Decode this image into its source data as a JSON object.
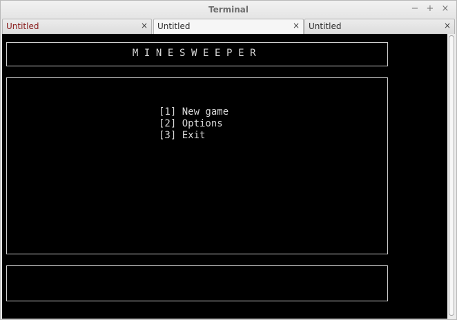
{
  "window": {
    "title": "Terminal",
    "controls": {
      "minimize": "−",
      "maximize": "+",
      "close": "×"
    }
  },
  "tabs": [
    {
      "label": "Untitled",
      "close": "×",
      "active": false,
      "highlight_color": "#8a1c1c"
    },
    {
      "label": "Untitled",
      "close": "×",
      "active": true
    },
    {
      "label": "Untitled",
      "close": "×",
      "active": false
    }
  ],
  "terminal": {
    "background": "#000000",
    "foreground": "#d8d8d8",
    "game_title": "MINESWEEPER",
    "menu": [
      {
        "label": "[1] New game"
      },
      {
        "label": "[2] Options"
      },
      {
        "label": "[3] Exit"
      }
    ],
    "status": ""
  }
}
